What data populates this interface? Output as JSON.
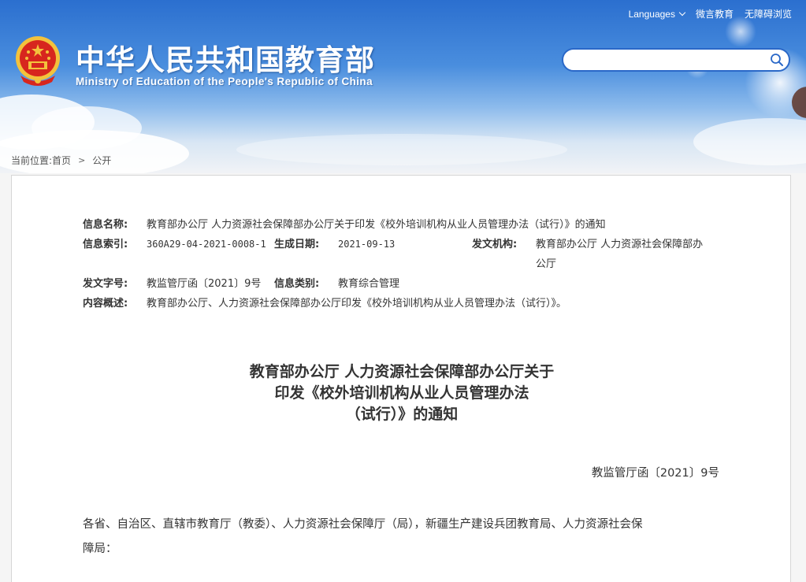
{
  "header": {
    "site_title": "中华人民共和国教育部",
    "site_subtitle": "Ministry of Education of the People's Republic of China",
    "top_links": {
      "languages": "Languages",
      "weiyan": "微言教育",
      "accessibility": "无障碍浏览"
    },
    "search": {
      "value": "",
      "placeholder": ""
    }
  },
  "breadcrumb": {
    "prefix": "当前位置:",
    "home": "首页",
    "current": "公开"
  },
  "meta": {
    "info_name_label": "信息名称:",
    "info_name": "教育部办公厅 人力资源社会保障部办公厅关于印发《校外培训机构从业人员管理办法（试行）》的通知",
    "info_index_label": "信息索引:",
    "info_index": "360A29-04-2021-0008-1",
    "date_label": "生成日期:",
    "date": "2021-09-13",
    "issuer_label": "发文机构:",
    "issuer_line1": "教育部办公厅 人力资源社会保障部办",
    "issuer_line2": "公厅",
    "doc_number_label": "发文字号:",
    "doc_number": "教监管厅函〔2021〕9号",
    "category_label": "信息类别:",
    "category": "教育综合管理",
    "summary_label": "内容概述:",
    "summary": "教育部办公厅、人力资源社会保障部办公厅印发《校外培训机构从业人员管理办法（试行）》。"
  },
  "document": {
    "title_line1": "教育部办公厅 人力资源社会保障部办公厅关于",
    "title_line2": "印发《校外培训机构从业人员管理办法",
    "title_line3": "（试行）》的通知",
    "doc_no": "教监管厅函〔2021〕9号",
    "body_line1": "各省、自治区、直辖市教育厅（教委）、人力资源社会保障厅（局），新疆生产建设兵团教育局、人力资源社会保",
    "body_line2": "障局："
  },
  "colors": {
    "banner_top": "#2b6fcf",
    "search_border": "#2a68c8",
    "emblem_red": "#d7261e",
    "emblem_gold": "#f3c23c"
  }
}
